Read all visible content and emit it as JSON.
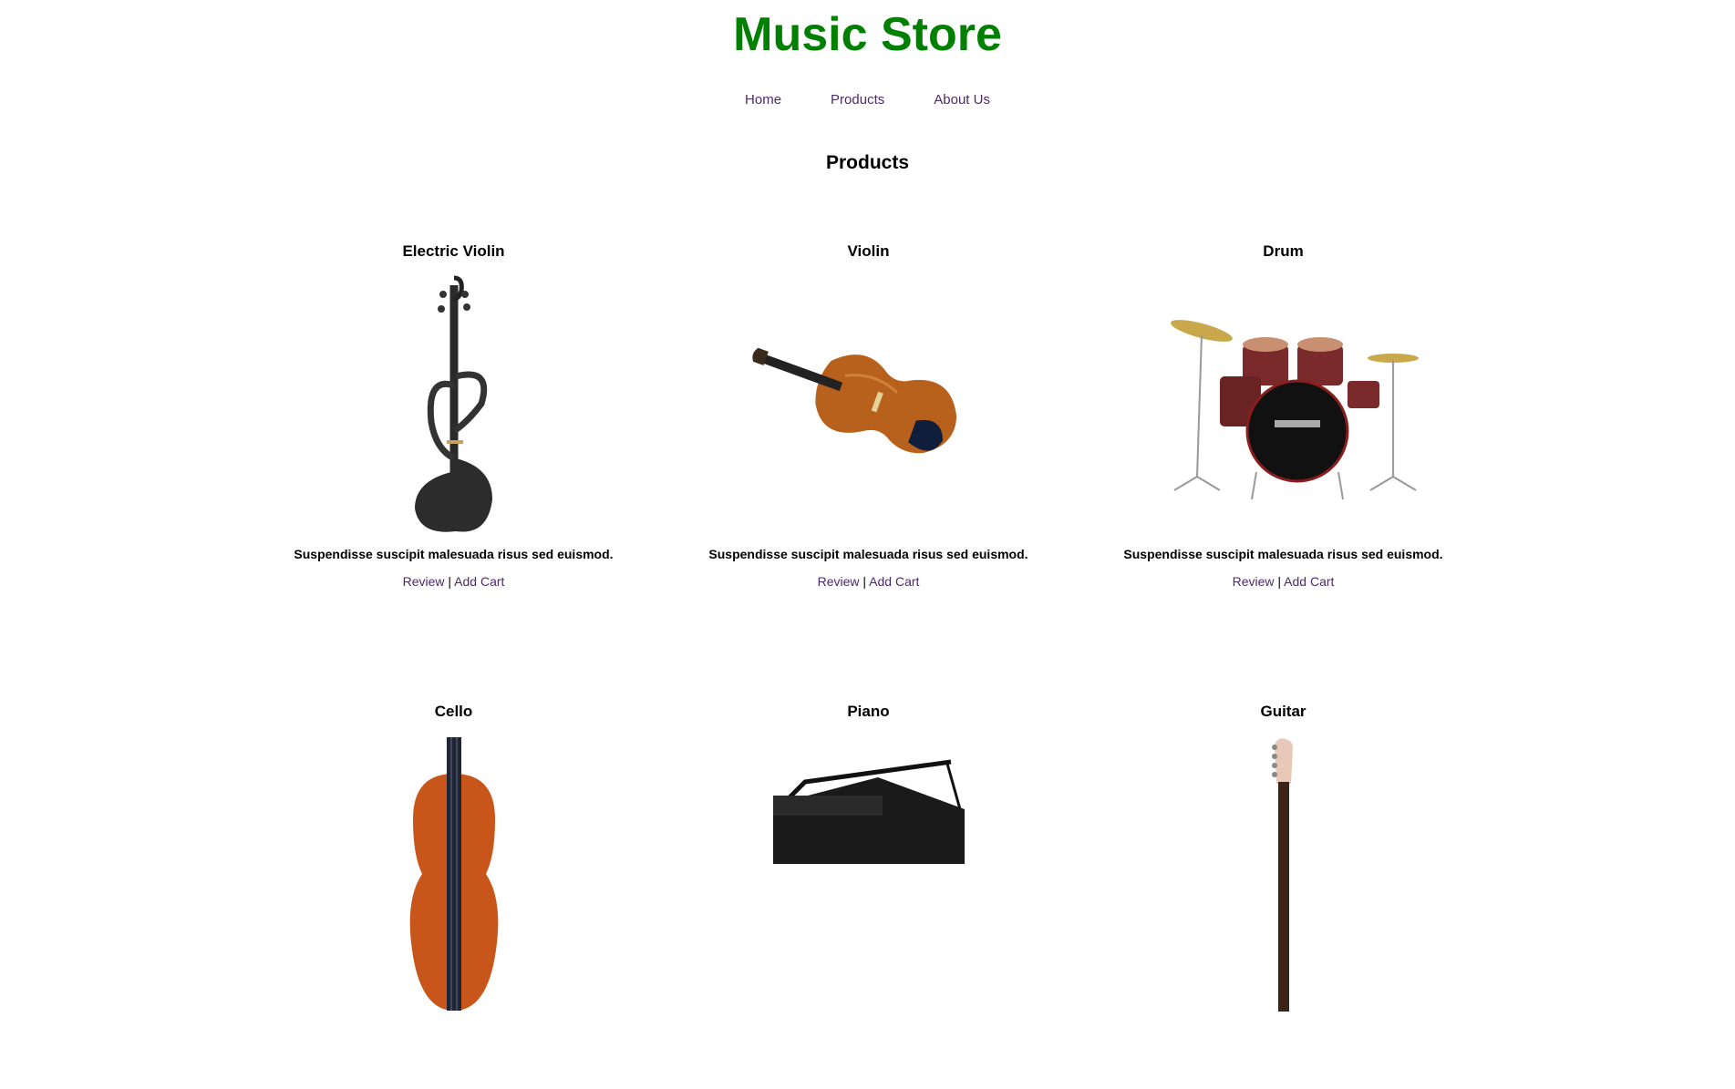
{
  "site": {
    "title": "Music Store"
  },
  "nav": [
    {
      "label": "Home"
    },
    {
      "label": "Products"
    },
    {
      "label": "About Us"
    }
  ],
  "section": {
    "title": "Products"
  },
  "products": [
    {
      "name": "Electric Violin",
      "description": "Suspendisse suscipit malesuada risus sed euismod.",
      "review_label": "Review",
      "separator": "|",
      "cart_label": "Add Cart",
      "image": "electric-violin-image"
    },
    {
      "name": "Violin",
      "description": "Suspendisse suscipit malesuada risus sed euismod.",
      "review_label": "Review",
      "separator": "|",
      "cart_label": "Add Cart",
      "image": "violin-image"
    },
    {
      "name": "Drum",
      "description": "Suspendisse suscipit malesuada risus sed euismod.",
      "review_label": "Review",
      "separator": "|",
      "cart_label": "Add Cart",
      "image": "drum-kit-image"
    },
    {
      "name": "Cello",
      "description": "",
      "image": "cello-image"
    },
    {
      "name": "Piano",
      "description": "",
      "image": "piano-image"
    },
    {
      "name": "Guitar",
      "description": "",
      "image": "guitar-image"
    }
  ],
  "colors": {
    "title": "#008000",
    "link": "#4b2a6b"
  }
}
